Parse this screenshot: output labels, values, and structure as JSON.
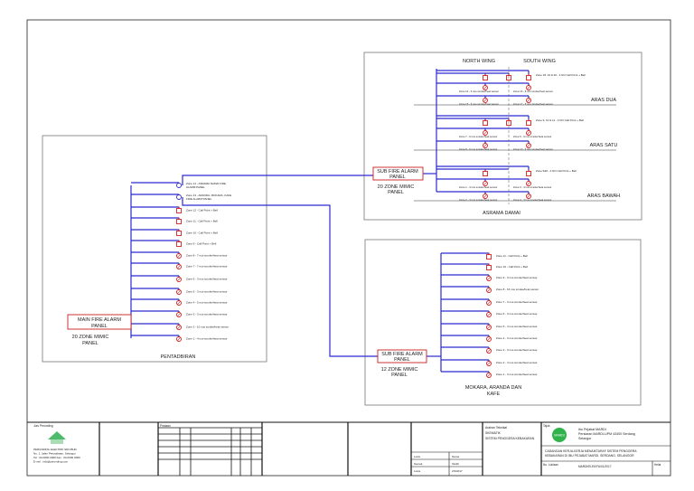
{
  "colors": {
    "bus": "#2b2bd0",
    "device": "#d42020",
    "panel_border": "#c81e1e",
    "logo_green": "#2fb34a"
  },
  "pentadbiran": {
    "title": "PENTADBIRAN",
    "panel_line1": "MAIN FIRE ALARM",
    "panel_line2": "PANEL",
    "mimic_line1": "20 ZONE MIMIC",
    "mimic_line2": "PANEL",
    "zones": [
      {
        "type": "link",
        "label1": "Zone 14 - ASRAMA DAMAI FIRE",
        "label2": "ALARM PANEL"
      },
      {
        "type": "link",
        "label1": "Zone 13 - ARANDA, MOKARA, KAFE",
        "label2": "FIRE ALARM PANEL"
      },
      {
        "type": "call",
        "label1": "Zone 12 - Call Point + Bell"
      },
      {
        "type": "call",
        "label1": "Zone 11 - Call Point + Bell"
      },
      {
        "type": "call",
        "label1": "Zone 10 - Call Point + Bell"
      },
      {
        "type": "call",
        "label1": "Zone 9 - Call Point + Bell"
      },
      {
        "type": "sensor",
        "label1": "Zone 8 - 7 nos smoke/heat sensor"
      },
      {
        "type": "sensor",
        "label1": "Zone 7 - 7 nos smoke/heat sensor"
      },
      {
        "type": "sensor",
        "label1": "Zone 6 - 3 nos smoke/heat sensor"
      },
      {
        "type": "sensor",
        "label1": "Zone 5 - 3 nos smoke/heat sensor"
      },
      {
        "type": "sensor",
        "label1": "Zone 4 - 5 nos smoke/heat sensor"
      },
      {
        "type": "sensor",
        "label1": "Zone 3 - 3 nos smoke/heat sensor"
      },
      {
        "type": "sensor",
        "label1": "Zone 2 - 10 nos smoke/heat sensor"
      },
      {
        "type": "sensor",
        "label1": "Zone 1 - 4 nos smoke/heat sensor"
      }
    ]
  },
  "asrama": {
    "title": "ASRAMA DAMAI",
    "north_wing": "NORTH  WING",
    "south_wing": "SOUTH WING",
    "panel_line1": "SUB FIRE ALARM",
    "panel_line2": "PANEL",
    "mimic_line1": "20 ZONE MIMIC",
    "mimic_line2": "PANEL",
    "floors": [
      {
        "name": "ARAS DUA",
        "call_label": "Zone 18, 19 & 20 - 3 NO Call Point + Bell",
        "call_count": 3,
        "rows": [
          [
            "Zone 14 - 6 nos smoke/heat sensor",
            "Zone 16 - 6 nos smoke/heat sensor"
          ],
          [
            "Zone 15 - 6 nos smoke/heat sensor",
            "Zone 17 - 6 nos smoke/heat sensor"
          ]
        ]
      },
      {
        "name": "ARAS SATU",
        "call_label": "Zone 9, 10 & 11 - 3 NO Call Point + Bell",
        "call_count": 3,
        "rows": [
          [
            "Zone 7 - 6 nos smoke/heat sensor",
            "Zone 5 - 6 nos smoke/heat sensor"
          ],
          [
            "Zone 8 - 6 nos smoke/heat sensor",
            "Zone 10 - 6 nos smoke/heat sensor"
          ]
        ]
      },
      {
        "name": "ARAS BAWAH",
        "call_label": "Zone 5&6 - 2 NO Call Point + Bell",
        "call_count": 2,
        "rows": [
          [
            "Zone 1 - 3 nos smoke/heat sensor",
            "Zone 3 - 3 nos smoke/heat sensor"
          ],
          [
            "Zone 2 - 3 nos smoke/heat sensor",
            "Zone 4 - 3 nos smoke/heat sensor"
          ]
        ]
      }
    ]
  },
  "mokara": {
    "title_line1": "MOKARA, ARANDA DAN",
    "title_line2": "KAFE",
    "panel_line1": "SUB FIRE ALARM",
    "panel_line2": "PANEL",
    "mimic_line1": "12 ZONE MIMIC",
    "mimic_line2": "PANEL",
    "zones": [
      {
        "type": "call",
        "label1": "Zone 11 - Call Point + Bell"
      },
      {
        "type": "call",
        "label1": "Zone 10 - Call Point + Bell"
      },
      {
        "type": "sensor",
        "label1": "Zone 9 - 3 nos smoke/heat sensor"
      },
      {
        "type": "sensor",
        "label1": "Zone 8 - 16 nos smoke/heat sensor"
      },
      {
        "type": "sensor",
        "label1": "Zone 7 - 3 nos smoke/heat sensor"
      },
      {
        "type": "sensor",
        "label1": "Zone 6 - 3 nos smoke/heat sensor"
      },
      {
        "type": "sensor",
        "label1": "Zone 5 - 4 nos smoke/heat sensor"
      },
      {
        "type": "sensor",
        "label1": "Zone 4 - 3 nos smoke/heat sensor"
      },
      {
        "type": "sensor",
        "label1": "Zone 3 - 3 nos smoke/heat sensor"
      },
      {
        "type": "sensor",
        "label1": "Zone 2 - 4 nos smoke/heat sensor"
      },
      {
        "type": "sensor",
        "label1": "Zone 1 - 3 nos smoke/heat sensor"
      }
    ]
  },
  "title_block": {
    "consultant_label": "Juru Perunding",
    "consultant_lines": [
      "PERUNDING ELEKTRIK SDN BHD",
      "No. 1, Jalan Perusahaan, Selangor",
      "Tel : 03-0000 0000  Fax : 03-0000 0000",
      "E-mel : info@perunding.com"
    ],
    "revision_label": "Pindaan",
    "technical_lines": [
      "Arahan Teknikal",
      "SKEMATIK",
      "SISTEM PENGGERA KEBAKARAN"
    ],
    "sign_rows": [
      [
        "Lukis",
        "Nama"
      ],
      [
        "Semak",
        "Tarikh"
      ],
      [
        "Lulus",
        "2/3/2017"
      ]
    ],
    "client_label": "Tajuk",
    "logo_text": "MARDI",
    "client_lines": [
      "Ibu Pejabat MARDI",
      "Persiaran MARDI-UPM 43400 Serdang",
      "Selangor"
    ],
    "project_lines": [
      "CADANGAN KERJA-KERJA MENAIKTARAF SISTEM PENGGERA",
      "KEBAKARAN DI IBU PEJABAT MARDI, SERDANG, SELANGOR"
    ],
    "drawing_no_label": "No. Lukisan",
    "drawing_no": "MARDI/ELEK/FA/01/2017",
    "sheet_label": "Helai"
  }
}
